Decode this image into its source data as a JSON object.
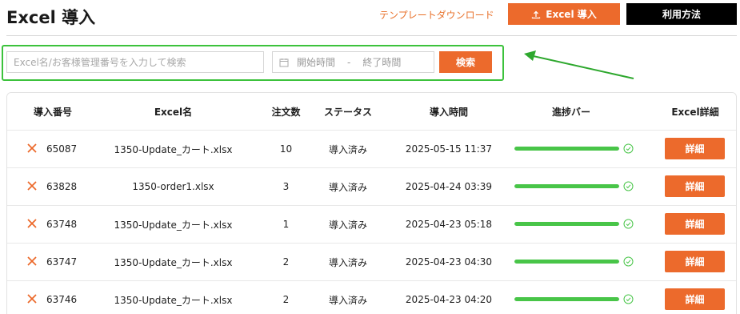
{
  "header": {
    "title": "Excel 導入",
    "template_link": "テンプレートダウンロード",
    "import_button": "Excel 導入",
    "usage_button": "利用方法"
  },
  "search": {
    "placeholder": "Excel名/お客様管理番号を入力して検索",
    "start_placeholder": "開始時間",
    "range_separator": "-",
    "end_placeholder": "終了時間",
    "search_button": "検索"
  },
  "table": {
    "columns": [
      "導入番号",
      "Excel名",
      "注文数",
      "ステータス",
      "導入時間",
      "進捗バー",
      "Excel詳細"
    ],
    "rows": [
      {
        "id": "65087",
        "file": "1350-Update_カート.xlsx",
        "orders": "10",
        "status": "導入済み",
        "time": "2025-05-15 11:37",
        "progress": 1.0,
        "action": "詳細"
      },
      {
        "id": "63828",
        "file": "1350-order1.xlsx",
        "orders": "3",
        "status": "導入済み",
        "time": "2025-04-24 03:39",
        "progress": 1.0,
        "action": "詳細"
      },
      {
        "id": "63748",
        "file": "1350-Update_カート.xlsx",
        "orders": "1",
        "status": "導入済み",
        "time": "2025-04-23 05:18",
        "progress": 1.0,
        "action": "詳細"
      },
      {
        "id": "63747",
        "file": "1350-Update_カート.xlsx",
        "orders": "2",
        "status": "導入済み",
        "time": "2025-04-23 04:30",
        "progress": 1.0,
        "action": "詳細"
      },
      {
        "id": "63746",
        "file": "1350-Update_カート.xlsx",
        "orders": "2",
        "status": "導入済み",
        "time": "2025-04-23 04:20",
        "progress": 1.0,
        "action": "詳細"
      }
    ]
  },
  "colors": {
    "accent": "#ec6a2c",
    "highlight": "#3cc23c",
    "progress": "#48c548"
  },
  "icons": {
    "import": "upload-icon",
    "date": "calendar-icon",
    "row_delete": "close-x-icon",
    "row_done": "check-circle-icon",
    "annotation": "green-arrow"
  }
}
